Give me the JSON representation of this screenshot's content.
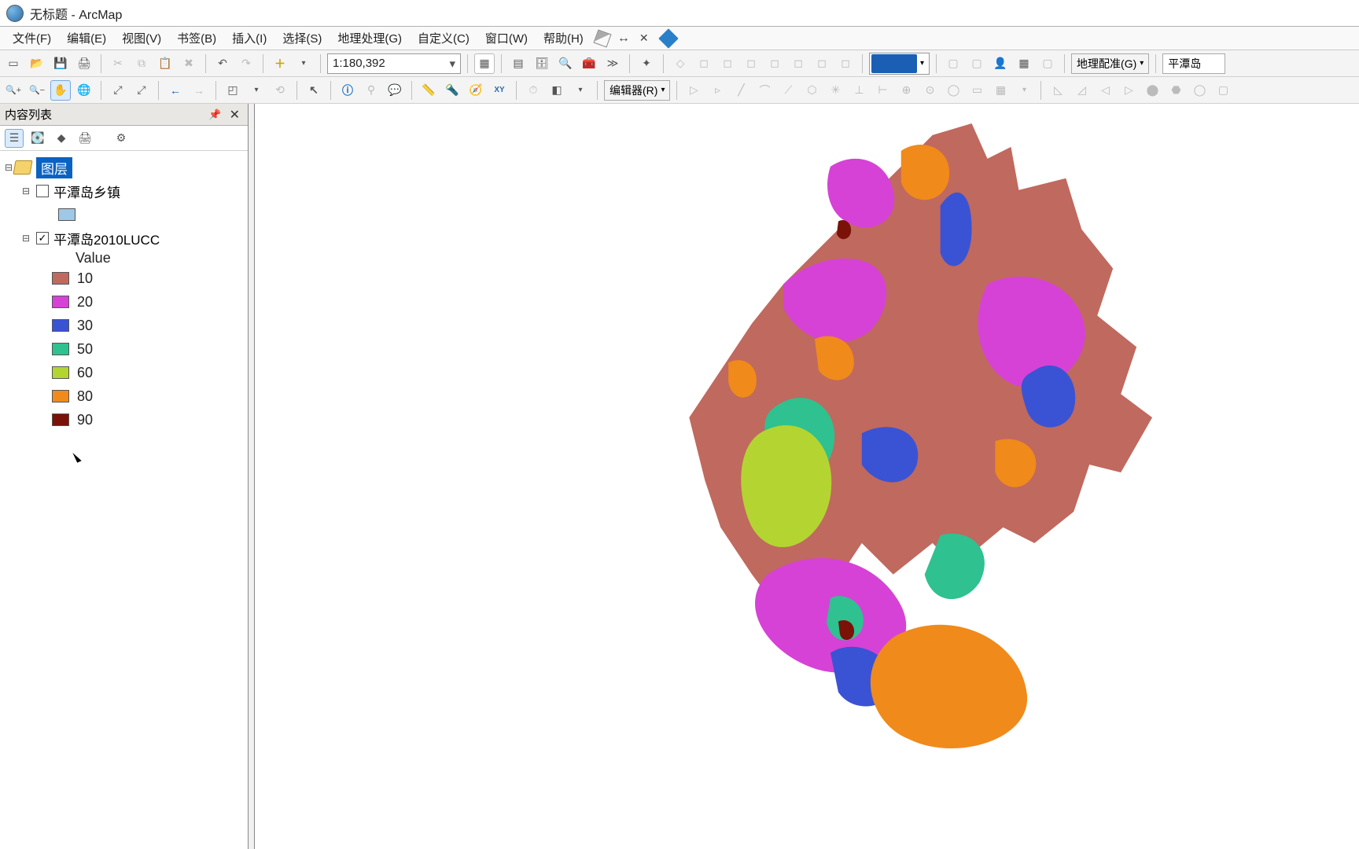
{
  "app": {
    "window_title": "无标题 - ArcMap"
  },
  "menu": {
    "file": "文件(F)",
    "edit": "编辑(E)",
    "view": "视图(V)",
    "bookmark": "书签(B)",
    "insert": "插入(I)",
    "select": "选择(S)",
    "geoprocessing": "地理处理(G)",
    "customize": "自定义(C)",
    "window": "窗口(W)",
    "help": "帮助(H)"
  },
  "toolbar": {
    "scale_text": "1:180,392",
    "editor_label": "编辑器(R)",
    "georef_label": "地理配准(G)",
    "georef_layer": "平潭岛"
  },
  "toc": {
    "panel_title": "内容列表",
    "root_label": "图层",
    "layer1": {
      "name": "平潭岛乡镇",
      "checked": false,
      "swatch_color": "#9fc7e6"
    },
    "layer2": {
      "name": "平潭岛2010LUCC",
      "checked": true,
      "field_label": "Value",
      "legend": [
        {
          "label": "10",
          "color": "#c0695e"
        },
        {
          "label": "20",
          "color": "#d642d6"
        },
        {
          "label": "30",
          "color": "#3a53d4"
        },
        {
          "label": "50",
          "color": "#2fc18f"
        },
        {
          "label": "60",
          "color": "#b4d432"
        },
        {
          "label": "80",
          "color": "#f08a1b"
        },
        {
          "label": "90",
          "color": "#7a1208"
        }
      ]
    }
  },
  "colors": {
    "c10": "#c0695e",
    "c20": "#d642d6",
    "c30": "#3a53d4",
    "c50": "#2fc18f",
    "c60": "#b4d432",
    "c80": "#f08a1b",
    "c90": "#7a1208"
  }
}
